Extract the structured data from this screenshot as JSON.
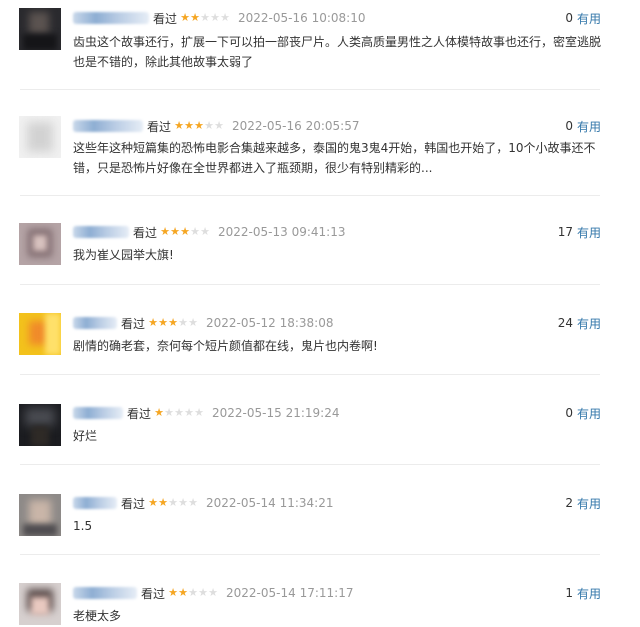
{
  "comments": [
    {
      "action": "看过",
      "rating": 2,
      "max_rating": 5,
      "time": "2022-05-16 10:08:10",
      "votes": "0",
      "vote_label": "有用",
      "content": "齿虫这个故事还行，扩展一下可以拍一部丧尸片。人类高质量男性之人体模特故事也还行，密室逃脱也是不错的，除此其他故事太弱了",
      "avatar_icon": "blurred-dark-photo-avatar"
    },
    {
      "action": "看过",
      "rating": 3,
      "max_rating": 5,
      "time": "2022-05-16 20:05:57",
      "votes": "0",
      "vote_label": "有用",
      "content": "这些年这种短篇集的恐怖电影合集越来越多，泰国的鬼3鬼4开始，韩国也开始了，10个小故事还不错，只是恐怖片好像在全世界都进入了瓶颈期，很少有特别精彩的...",
      "avatar_icon": "blurred-light-avatar"
    },
    {
      "action": "看过",
      "rating": 3,
      "max_rating": 5,
      "time": "2022-05-13 09:41:13",
      "votes": "17",
      "vote_label": "有用",
      "content": "我为崔乂园举大旗!",
      "avatar_icon": "blurred-portrait-avatar"
    },
    {
      "action": "看过",
      "rating": 3,
      "max_rating": 5,
      "time": "2022-05-12 18:38:08",
      "votes": "24",
      "vote_label": "有用",
      "content": "剧情的确老套，奈何每个短片颜值都在线，鬼片也内卷啊!",
      "avatar_icon": "blurred-yellow-avatar"
    },
    {
      "action": "看过",
      "rating": 1,
      "max_rating": 5,
      "time": "2022-05-15 21:19:24",
      "votes": "0",
      "vote_label": "有用",
      "content": "好烂",
      "avatar_icon": "blurred-dark-scene-avatar"
    },
    {
      "action": "看过",
      "rating": 2,
      "max_rating": 5,
      "time": "2022-05-14 11:34:21",
      "votes": "2",
      "vote_label": "有用",
      "content": "1.5",
      "avatar_icon": "blurred-person-avatar"
    },
    {
      "action": "看过",
      "rating": 2,
      "max_rating": 5,
      "time": "2022-05-14 17:11:17",
      "votes": "1",
      "vote_label": "有用",
      "content": "老梗太多",
      "avatar_icon": "blurred-portrait-avatar"
    }
  ]
}
